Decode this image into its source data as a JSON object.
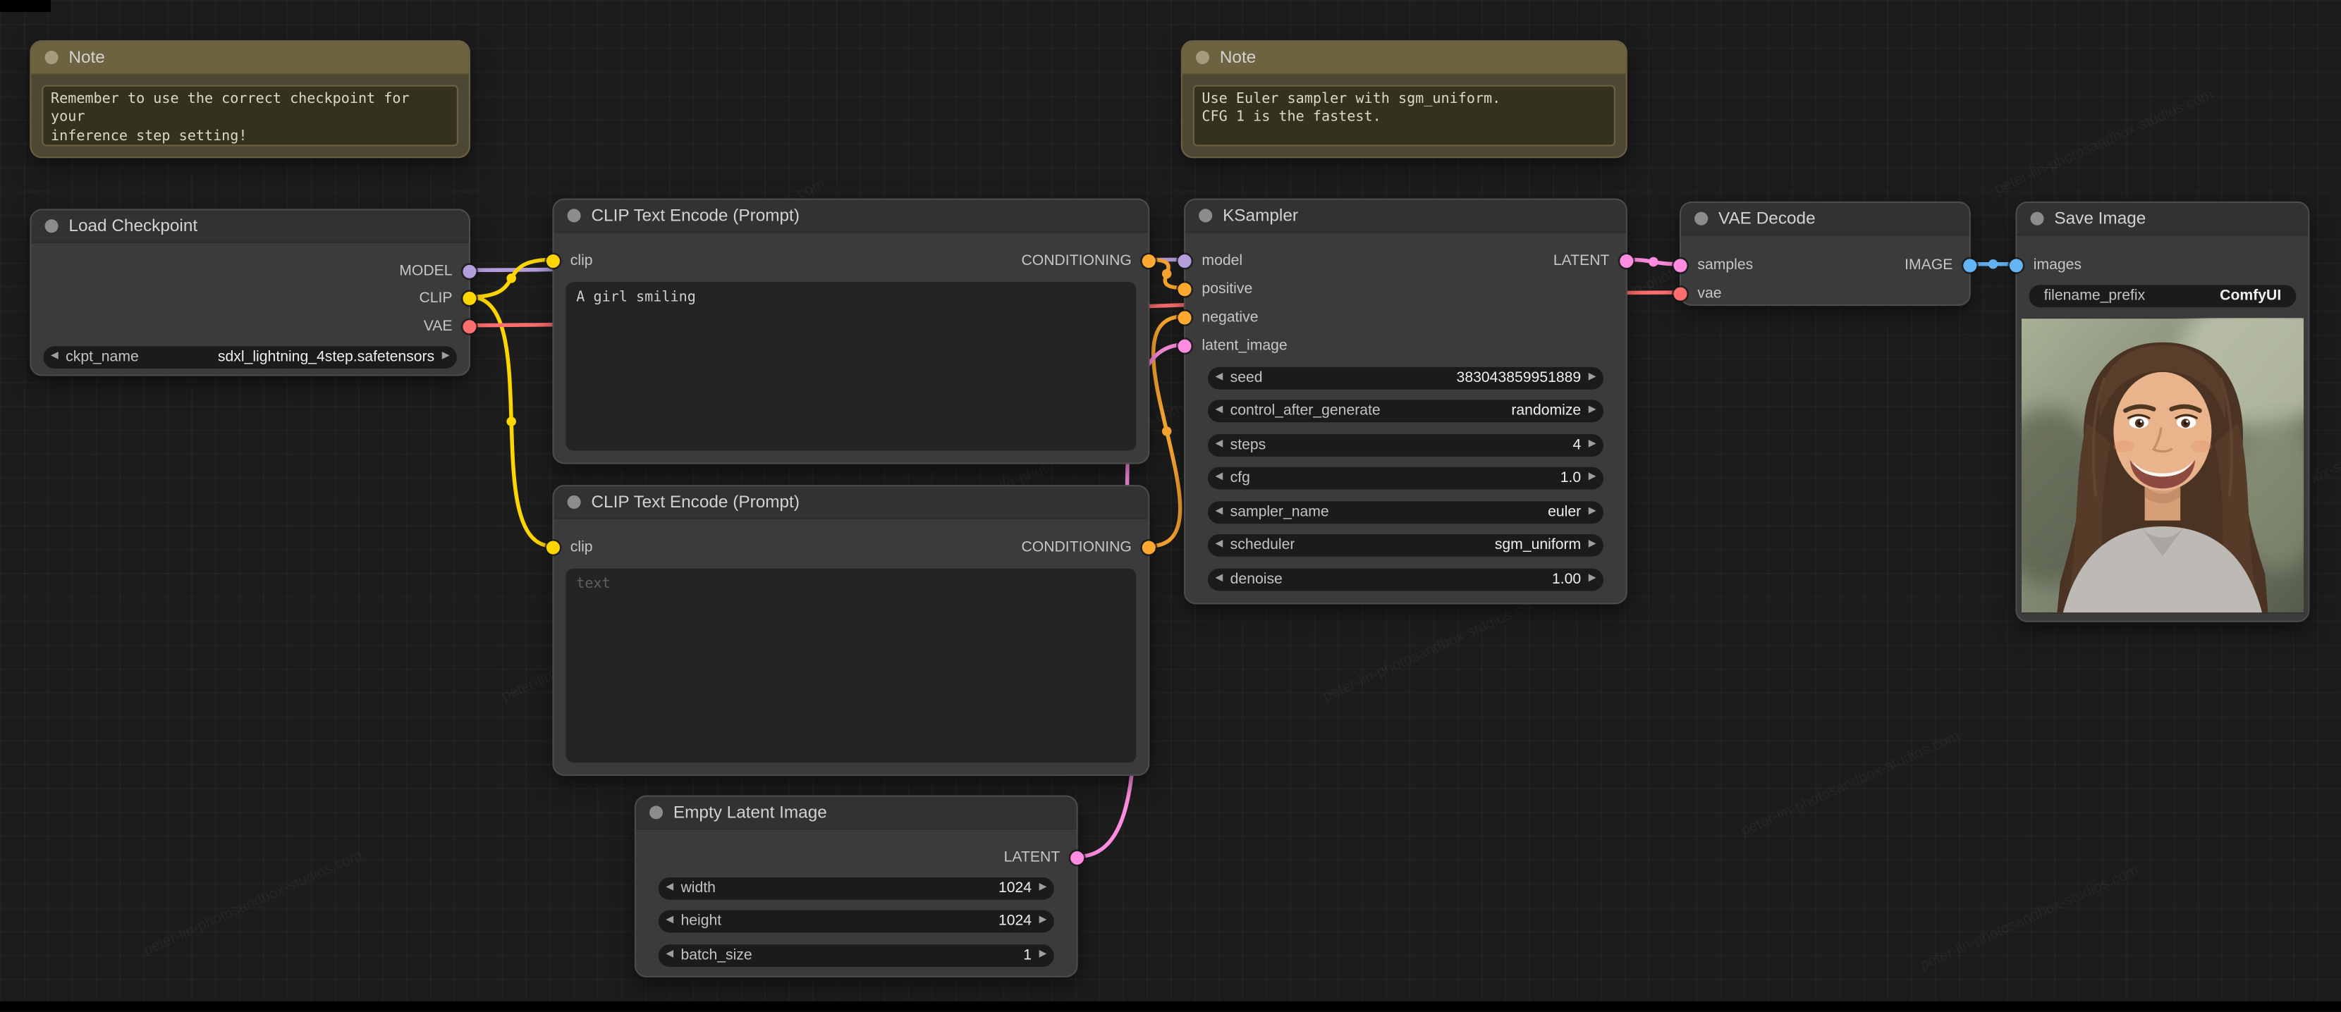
{
  "watermark": {
    "text": "peter-lin-photosandbox-studios.com"
  },
  "colors": {
    "model": "#B39DDB",
    "clip": "#FFD500",
    "vae": "#FF6E6E",
    "conditioning": "#FFA931",
    "latent": "#FF8CE0",
    "image": "#64B5F6"
  },
  "notes": [
    {
      "title": "Note",
      "text": "Remember to use the correct checkpoint for your\ninference step setting!"
    },
    {
      "title": "Note",
      "text": "Use Euler sampler with sgm_uniform.\nCFG 1 is the fastest."
    }
  ],
  "load_checkpoint": {
    "title": "Load Checkpoint",
    "outputs": {
      "model": "MODEL",
      "clip": "CLIP",
      "vae": "VAE"
    },
    "widget": {
      "label": "ckpt_name",
      "value": "sdxl_lightning_4step.safetensors"
    }
  },
  "clip_encode_1": {
    "title": "CLIP Text Encode (Prompt)",
    "input": "clip",
    "output": "CONDITIONING",
    "text": "A girl smiling"
  },
  "clip_encode_2": {
    "title": "CLIP Text Encode (Prompt)",
    "input": "clip",
    "output": "CONDITIONING",
    "placeholder": "text"
  },
  "ksampler": {
    "title": "KSampler",
    "inputs": {
      "model": "model",
      "positive": "positive",
      "negative": "negative",
      "latent_image": "latent_image"
    },
    "output": "LATENT",
    "widgets": [
      {
        "label": "seed",
        "value": "383043859951889"
      },
      {
        "label": "control_after_generate",
        "value": "randomize"
      },
      {
        "label": "steps",
        "value": "4"
      },
      {
        "label": "cfg",
        "value": "1.0"
      },
      {
        "label": "sampler_name",
        "value": "euler"
      },
      {
        "label": "scheduler",
        "value": "sgm_uniform"
      },
      {
        "label": "denoise",
        "value": "1.00"
      }
    ]
  },
  "empty_latent": {
    "title": "Empty Latent Image",
    "output": "LATENT",
    "widgets": [
      {
        "label": "width",
        "value": "1024"
      },
      {
        "label": "height",
        "value": "1024"
      },
      {
        "label": "batch_size",
        "value": "1"
      }
    ]
  },
  "vae_decode": {
    "title": "VAE Decode",
    "inputs": {
      "samples": "samples",
      "vae": "vae"
    },
    "output": "IMAGE"
  },
  "save_image": {
    "title": "Save Image",
    "input": "images",
    "widget": {
      "label": "filename_prefix",
      "value": "ComfyUI"
    }
  }
}
